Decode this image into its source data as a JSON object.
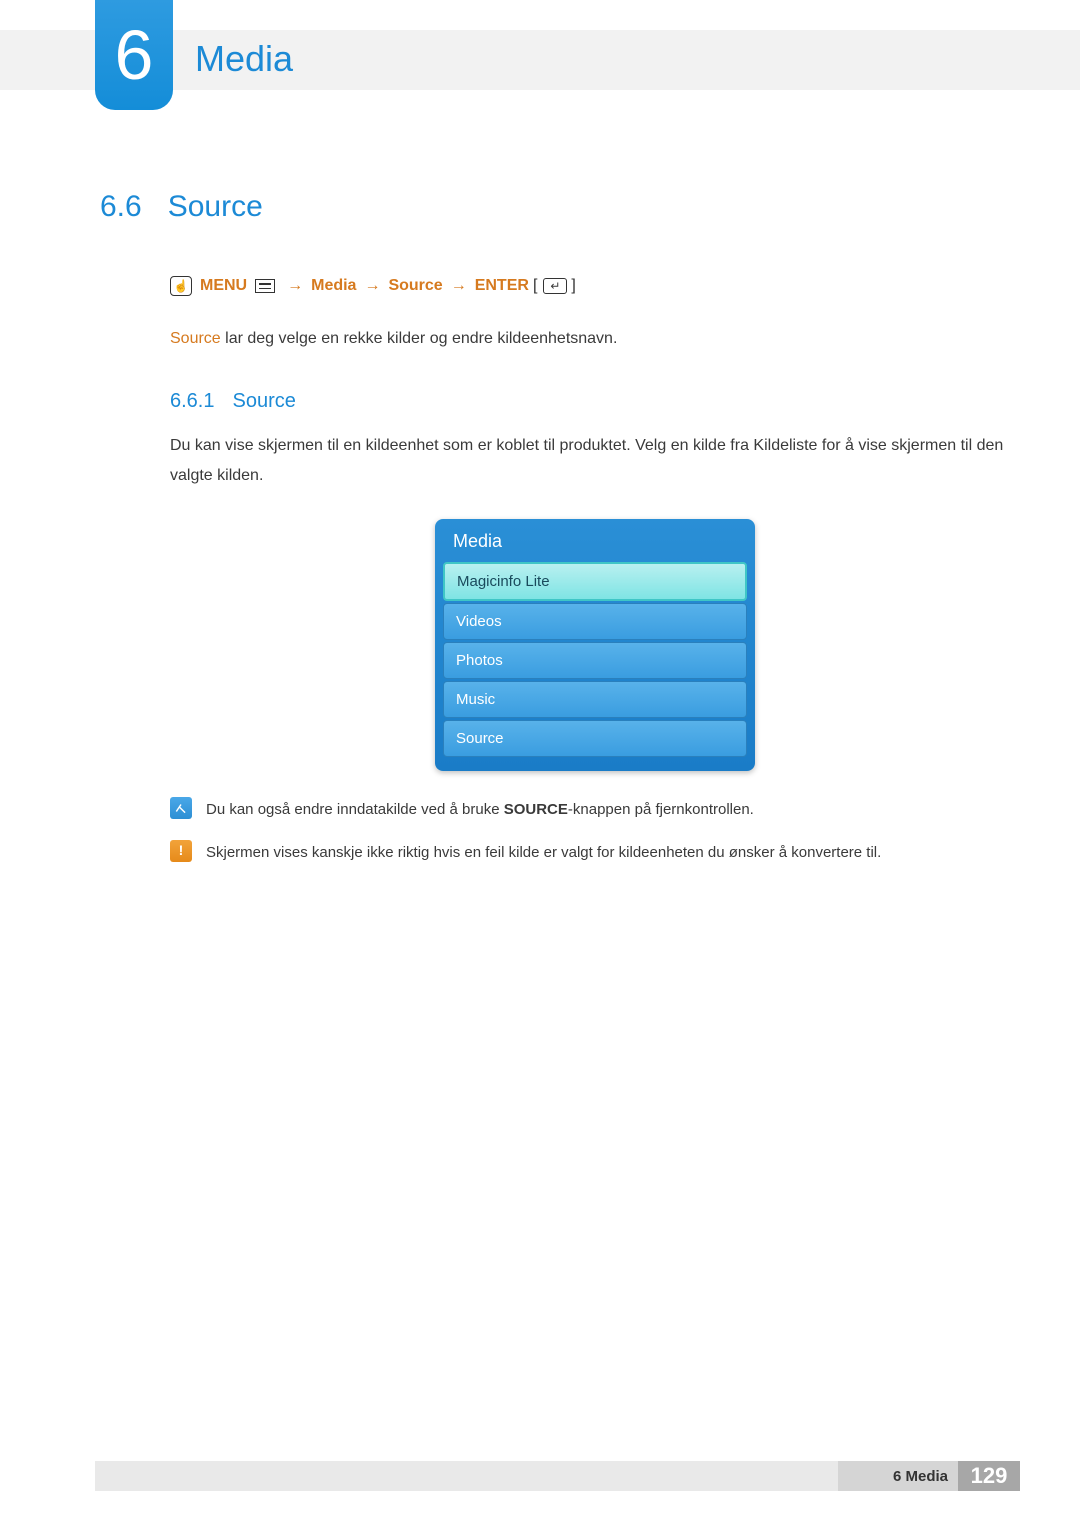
{
  "chapter": {
    "number": "6",
    "title": "Media"
  },
  "section": {
    "number": "6.6",
    "title": "Source"
  },
  "navpath": {
    "menu_label": "MENU",
    "seg1": "Media",
    "seg2": "Source",
    "enter_label": "ENTER"
  },
  "intro": {
    "head": "Source",
    "text": " lar deg velge en rekke kilder og endre kildeenhetsnavn."
  },
  "subsection": {
    "number": "6.6.1",
    "title": "Source"
  },
  "paragraph": "Du kan vise skjermen til en kildeenhet som er koblet til produktet. Velg en kilde fra Kildeliste for å vise skjermen til den valgte kilden.",
  "menu": {
    "title": "Media",
    "items": [
      {
        "label": "Magicinfo Lite",
        "selected": true
      },
      {
        "label": "Videos",
        "selected": false
      },
      {
        "label": "Photos",
        "selected": false
      },
      {
        "label": "Music",
        "selected": false
      },
      {
        "label": "Source",
        "selected": false
      }
    ]
  },
  "note": {
    "pre": "Du kan også endre inndatakilde ved å bruke ",
    "bold": "SOURCE",
    "post": "-knappen på fjernkontrollen."
  },
  "warning": "Skjermen vises kanskje ikke riktig hvis en feil kilde er valgt for kildeenheten du ønsker å konvertere til.",
  "footer": {
    "chapter_label": "6 Media",
    "page": "129"
  }
}
